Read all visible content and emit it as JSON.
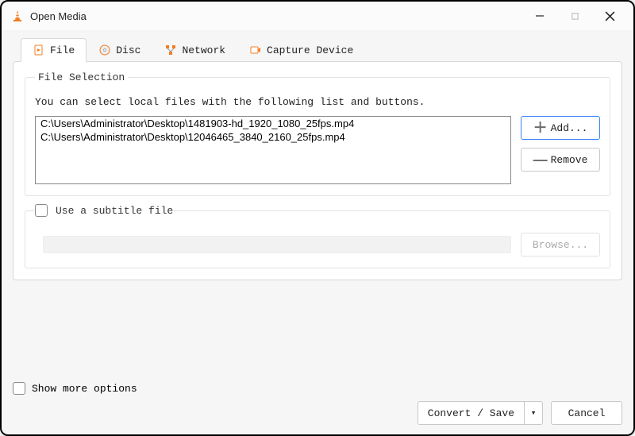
{
  "window": {
    "title": "Open Media"
  },
  "tabs": {
    "file": "File",
    "disc": "Disc",
    "network": "Network",
    "capture": "Capture Device"
  },
  "file_selection": {
    "legend": "File Selection",
    "help": "You can select local files with the following list and buttons.",
    "files": [
      "C:\\Users\\Administrator\\Desktop\\1481903-hd_1920_1080_25fps.mp4",
      "C:\\Users\\Administrator\\Desktop\\12046465_3840_2160_25fps.mp4"
    ],
    "add": "Add...",
    "remove": "Remove"
  },
  "subtitle": {
    "label": "Use a subtitle file",
    "browse": "Browse..."
  },
  "options": {
    "show_more": "Show more options"
  },
  "actions": {
    "convert": "Convert / Save",
    "dropdown_glyph": "▾",
    "cancel": "Cancel"
  }
}
